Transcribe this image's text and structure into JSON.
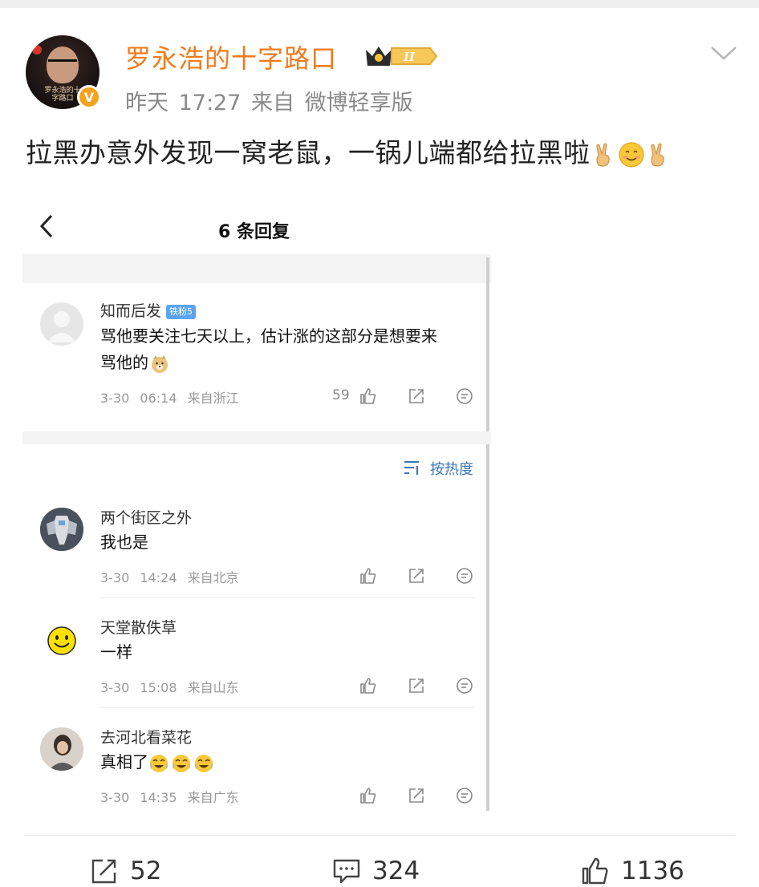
{
  "post": {
    "author": "罗永浩的十字路口",
    "avatar_text": "罗永浩的十字路口",
    "member_badge": "II",
    "time": "昨天 17:27",
    "source": "来自 微博轻享版",
    "text": "拉黑办意外发现一窝老鼠，一锅儿端都给拉黑啦",
    "emojis": [
      "victory-hand",
      "smiling-face",
      "victory-hand"
    ]
  },
  "screenshot": {
    "title": "6 条回复",
    "sort_label": "按热度",
    "top_comment": {
      "name": "知而后发",
      "badge": "铁粉5",
      "text_line1": "骂他要关注七天以上，估计涨的这部分是想要来",
      "text_line2": "骂他的",
      "time": "3-30 06:14",
      "location": "来自浙江",
      "likes": "59"
    },
    "replies": [
      {
        "name": "两个街区之外",
        "text": "我也是",
        "time": "3-30 14:24",
        "location": "来自北京"
      },
      {
        "name": "天堂散佚草",
        "text": "一样",
        "time": "3-30 15:08",
        "location": "来自山东"
      },
      {
        "name": "去河北看菜花",
        "text": "真相了",
        "time": "3-30 14:35",
        "location": "来自广东"
      }
    ]
  },
  "footer": {
    "reposts": "52",
    "comments": "324",
    "likes": "1136"
  },
  "colors": {
    "author_orange": "#f27a1a",
    "meta_gray": "#8a8a8a",
    "link_blue": "#3b76b9"
  }
}
